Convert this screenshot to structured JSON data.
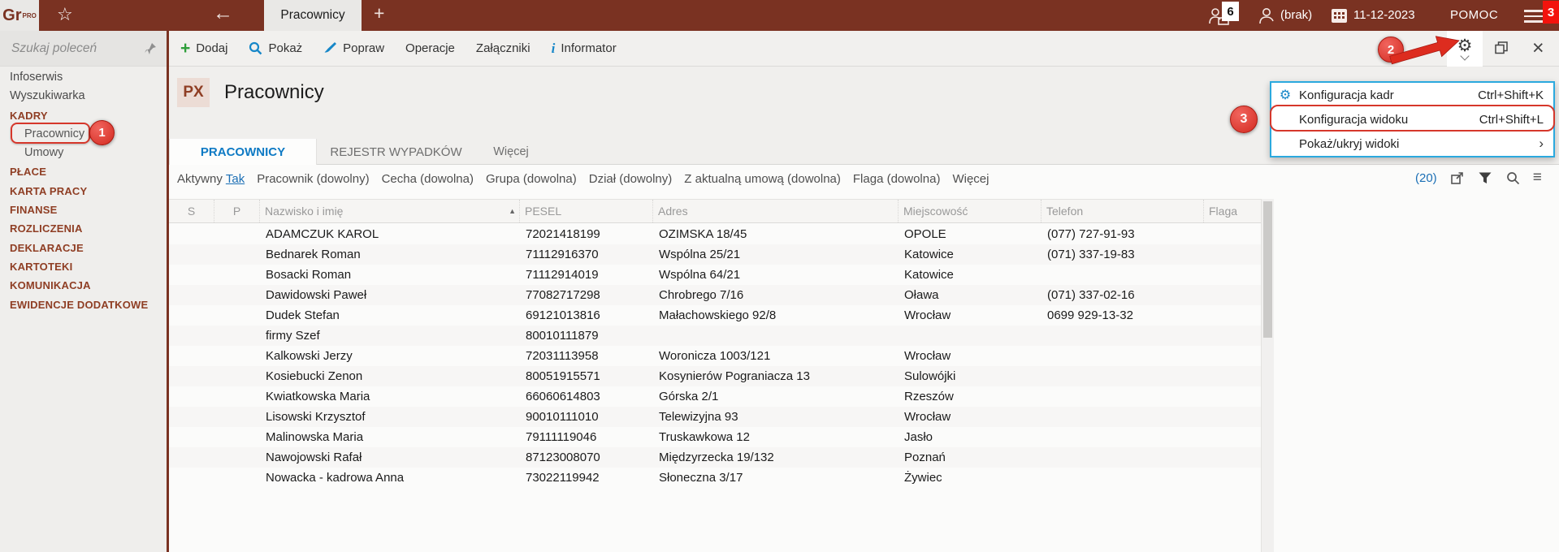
{
  "chrome": {
    "logo": {
      "text": "Gr",
      "sup": "PRO"
    },
    "window_tab": "Pracownicy",
    "top_right": {
      "sessions_badge": "6",
      "user": "(brak)",
      "date": "11-12-2023",
      "help": "POMOC",
      "menu_badge": "3"
    }
  },
  "sidebar": {
    "search_placeholder": "Szukaj poleceń",
    "items": [
      {
        "label": "Infoserwis",
        "type": "top"
      },
      {
        "label": "Wyszukiwarka",
        "type": "top"
      },
      {
        "label": "KADRY",
        "type": "section"
      },
      {
        "label": "Pracownicy",
        "type": "sub",
        "annotated": true
      },
      {
        "label": "Umowy",
        "type": "sub"
      },
      {
        "label": "PŁACE",
        "type": "section"
      },
      {
        "label": "KARTA PRACY",
        "type": "section"
      },
      {
        "label": "FINANSE",
        "type": "section"
      },
      {
        "label": "ROZLICZENIA",
        "type": "section"
      },
      {
        "label": "DEKLARACJE",
        "type": "section"
      },
      {
        "label": "KARTOTEKI",
        "type": "section"
      },
      {
        "label": "KOMUNIKACJA",
        "type": "section"
      },
      {
        "label": "EWIDENCJE DODATKOWE",
        "type": "section"
      }
    ]
  },
  "toolbar": {
    "buttons": [
      {
        "label": "Dodaj",
        "icon": "plus"
      },
      {
        "label": "Pokaż",
        "icon": "magnifier"
      },
      {
        "label": "Popraw",
        "icon": "brush"
      },
      {
        "label": "Operacje",
        "icon": ""
      },
      {
        "label": "Załączniki",
        "icon": ""
      },
      {
        "label": "Informator",
        "icon": "info"
      }
    ]
  },
  "page": {
    "code": "PX",
    "title": "Pracownicy"
  },
  "view_tabs": [
    {
      "label": "PRACOWNICY",
      "active": true
    },
    {
      "label": "REJESTR WYPADKÓW",
      "active": false
    },
    {
      "label": "Więcej",
      "active": false
    }
  ],
  "filters": {
    "items": [
      {
        "label": "Aktywny",
        "value": "Tak"
      },
      {
        "label": "Pracownik (dowolny)",
        "value": ""
      },
      {
        "label": "Cecha (dowolna)",
        "value": ""
      },
      {
        "label": "Grupa (dowolna)",
        "value": ""
      },
      {
        "label": "Dział (dowolny)",
        "value": ""
      },
      {
        "label": "Z aktualną umową (dowolna)",
        "value": ""
      },
      {
        "label": "Flaga (dowolna)",
        "value": ""
      },
      {
        "label": "Więcej",
        "value": ""
      }
    ],
    "count": "(20)"
  },
  "table": {
    "columns": [
      "S",
      "P",
      "Nazwisko i imię",
      "PESEL",
      "Adres",
      "Miejscowość",
      "Telefon",
      "Flaga"
    ],
    "sort_column": "Nazwisko i imię",
    "sort_direction": "asc",
    "rows": [
      {
        "name": "ADAMCZUK KAROL",
        "pesel": "72021418199",
        "adres": "OZIMSKA 18/45",
        "city": "OPOLE",
        "phone": "(077) 727-91-93",
        "flag": ""
      },
      {
        "name": "Bednarek Roman",
        "pesel": "71112916370",
        "adres": "Wspólna 25/21",
        "city": "Katowice",
        "phone": "(071) 337-19-83",
        "flag": ""
      },
      {
        "name": "Bosacki Roman",
        "pesel": "71112914019",
        "adres": "Wspólna 64/21",
        "city": "Katowice",
        "phone": "",
        "flag": ""
      },
      {
        "name": "Dawidowski Paweł",
        "pesel": "77082717298",
        "adres": "Chrobrego 7/16",
        "city": "Oława",
        "phone": "(071) 337-02-16",
        "flag": ""
      },
      {
        "name": "Dudek Stefan",
        "pesel": "69121013816",
        "adres": "Małachowskiego 92/8",
        "city": "Wrocław",
        "phone": "0699 929-13-32",
        "flag": ""
      },
      {
        "name": "firmy Szef",
        "pesel": "80010111879",
        "adres": "",
        "city": "",
        "phone": "",
        "flag": ""
      },
      {
        "name": "Kalkowski Jerzy",
        "pesel": "72031113958",
        "adres": "Woronicza 1003/121",
        "city": "Wrocław",
        "phone": "",
        "flag": ""
      },
      {
        "name": "Kosiebucki Zenon",
        "pesel": "80051915571",
        "adres": "Kosynierów Pograniacza 13",
        "city": "Sulowójki",
        "phone": "",
        "flag": ""
      },
      {
        "name": "Kwiatkowska Maria",
        "pesel": "66060614803",
        "adres": "Górska 2/1",
        "city": "Rzeszów",
        "phone": "",
        "flag": ""
      },
      {
        "name": "Lisowski Krzysztof",
        "pesel": "90010111010",
        "adres": "Telewizyjna 93",
        "city": "Wrocław",
        "phone": "",
        "flag": ""
      },
      {
        "name": "Malinowska Maria",
        "pesel": "79111119046",
        "adres": "Truskawkowa 12",
        "city": "Jasło",
        "phone": "",
        "flag": ""
      },
      {
        "name": "Nawojowski Rafał",
        "pesel": "87123008070",
        "adres": "Międzyrzecka 19/132",
        "city": "Poznań",
        "phone": "",
        "flag": ""
      },
      {
        "name": "Nowacka - kadrowa Anna",
        "pesel": "73022119942",
        "adres": "Słoneczna 3/17",
        "city": "Żywiec",
        "phone": "",
        "flag": ""
      }
    ]
  },
  "context_menu": {
    "items": [
      {
        "label": "Konfiguracja kadr",
        "shortcut": "Ctrl+Shift+K",
        "icon": "gear",
        "submenu": false,
        "annotated": false
      },
      {
        "label": "Konfiguracja widoku",
        "shortcut": "Ctrl+Shift+L",
        "icon": "",
        "submenu": false,
        "annotated": true
      },
      {
        "label": "Pokaż/ukryj widoki",
        "shortcut": "",
        "icon": "",
        "submenu": true,
        "annotated": false
      }
    ]
  },
  "annotations": {
    "step1": "1",
    "step2": "2",
    "step3": "3"
  }
}
